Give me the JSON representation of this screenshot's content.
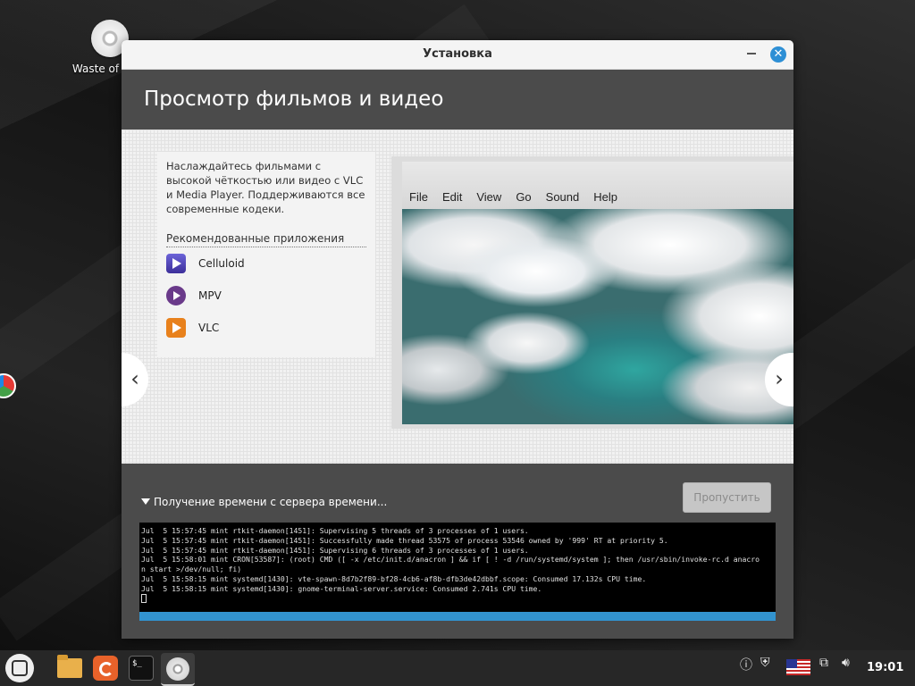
{
  "desktop": {
    "icon_label": "Waste of"
  },
  "window": {
    "title": "Установка",
    "header": "Просмотр фильмов и видео",
    "slide": {
      "description": "Наслаждайтесь фильмами с высокой чёткостью или видео с VLC и Media Player. Поддерживаются все современные кодеки.",
      "recommended_title": "Рекомендованные приложения",
      "apps": [
        {
          "name": "Celluloid",
          "icon": "celluloid-icon"
        },
        {
          "name": "MPV",
          "icon": "mpv-icon"
        },
        {
          "name": "VLC",
          "icon": "vlc-icon"
        }
      ],
      "player_menu": [
        "File",
        "Edit",
        "View",
        "Go",
        "Sound",
        "Help"
      ],
      "prev_arrow": "‹",
      "next_arrow": "›"
    },
    "status": "Получение времени с сервера времени...",
    "skip_button": "Пропустить",
    "terminal_lines": [
      "Jul  5 15:57:45 mint rtkit-daemon[1451]: Supervising 5 threads of 3 processes of 1 users.",
      "Jul  5 15:57:45 mint rtkit-daemon[1451]: Successfully made thread 53575 of process 53546 owned by '999' RT at priority 5.",
      "Jul  5 15:57:45 mint rtkit-daemon[1451]: Supervising 6 threads of 3 processes of 1 users.",
      "Jul  5 15:58:01 mint CRON[53587]: (root) CMD ([ -x /etc/init.d/anacron ] && if [ ! -d /run/systemd/system ]; then /usr/sbin/invoke-rc.d anacro",
      "n start >/dev/null; fi)",
      "Jul  5 15:58:15 mint systemd[1430]: vte-spawn-8d7b2f89-bf28-4cb6-af8b-dfb3de42dbbf.scope: Consumed 17.132s CPU time.",
      "Jul  5 15:58:15 mint systemd[1430]: gnome-terminal-server.service: Consumed 2.741s CPU time."
    ],
    "progress_fraction": 1.0
  },
  "taskbar": {
    "clock": "19:01",
    "tray_icons": [
      "update-icon",
      "shield-icon",
      "us-flag-icon",
      "network-icon",
      "volume-icon"
    ]
  },
  "colors": {
    "accent": "#3293cf",
    "window_bg": "#4b4b4b",
    "close_button": "#2d8fd5"
  }
}
